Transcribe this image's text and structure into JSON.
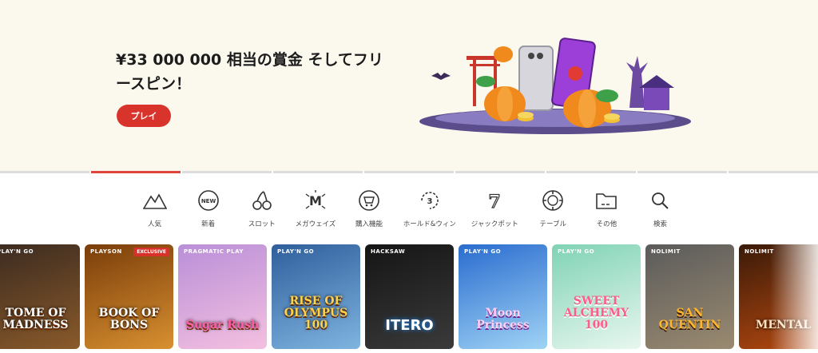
{
  "hero": {
    "title": "¥33 000 000 相当の賞金 そしてフリースピン！",
    "play_label": "プレイ"
  },
  "categories": [
    {
      "label": "人気",
      "icon": "mountain-icon"
    },
    {
      "label": "新着",
      "icon": "new-badge-icon"
    },
    {
      "label": "スロット",
      "icon": "cherry-icon"
    },
    {
      "label": "メガウェイズ",
      "icon": "megaways-icon"
    },
    {
      "label": "購入機能",
      "icon": "buy-feature-icon"
    },
    {
      "label": "ホールド&ウィン",
      "icon": "hold-and-win-icon"
    },
    {
      "label": "ジャックポット",
      "icon": "jackpot-icon"
    },
    {
      "label": "テーブル",
      "icon": "chip-icon"
    },
    {
      "label": "その他",
      "icon": "folder-icon"
    },
    {
      "label": "検索",
      "icon": "search-icon"
    }
  ],
  "games": [
    {
      "title": "TOME OF MADNESS",
      "provider": "PLAY'N GO",
      "color": "#3a2a20",
      "color2": "#8a5a2a"
    },
    {
      "title": "BOOK OF BONS",
      "provider": "PLAYSON",
      "badge": "EXCLUSIVE",
      "color": "#7a3d0a",
      "color2": "#d89030"
    },
    {
      "title": "Sugar Rush",
      "provider": "PRAGMATIC PLAY",
      "color": "#b98fd8",
      "color2": "#f4c0e0"
    },
    {
      "title": "RISE OF OLYMPUS 100",
      "provider": "PLAY'N GO",
      "color": "#2f5f9c",
      "color2": "#7fb4e0"
    },
    {
      "title": "ITERO",
      "provider": "HACKSAW",
      "color": "#151515",
      "color2": "#3a3a3a"
    },
    {
      "title": "Moon Princess",
      "provider": "PLAY'N GO",
      "color": "#2a6ccf",
      "color2": "#9fd3f5"
    },
    {
      "title": "SWEET ALCHEMY 100",
      "provider": "PLAY'N GO",
      "color": "#7fd3b4",
      "color2": "#e8f7ef"
    },
    {
      "title": "SAN QUENTIN",
      "provider": "NOLIMIT",
      "color": "#5b5b5b",
      "color2": "#9a8a70"
    },
    {
      "title": "MENTAL",
      "provider": "NOLIMIT",
      "color": "#3a1a08",
      "color2": "#b84a10"
    }
  ],
  "progress": {
    "segments": 9,
    "active": 1
  }
}
